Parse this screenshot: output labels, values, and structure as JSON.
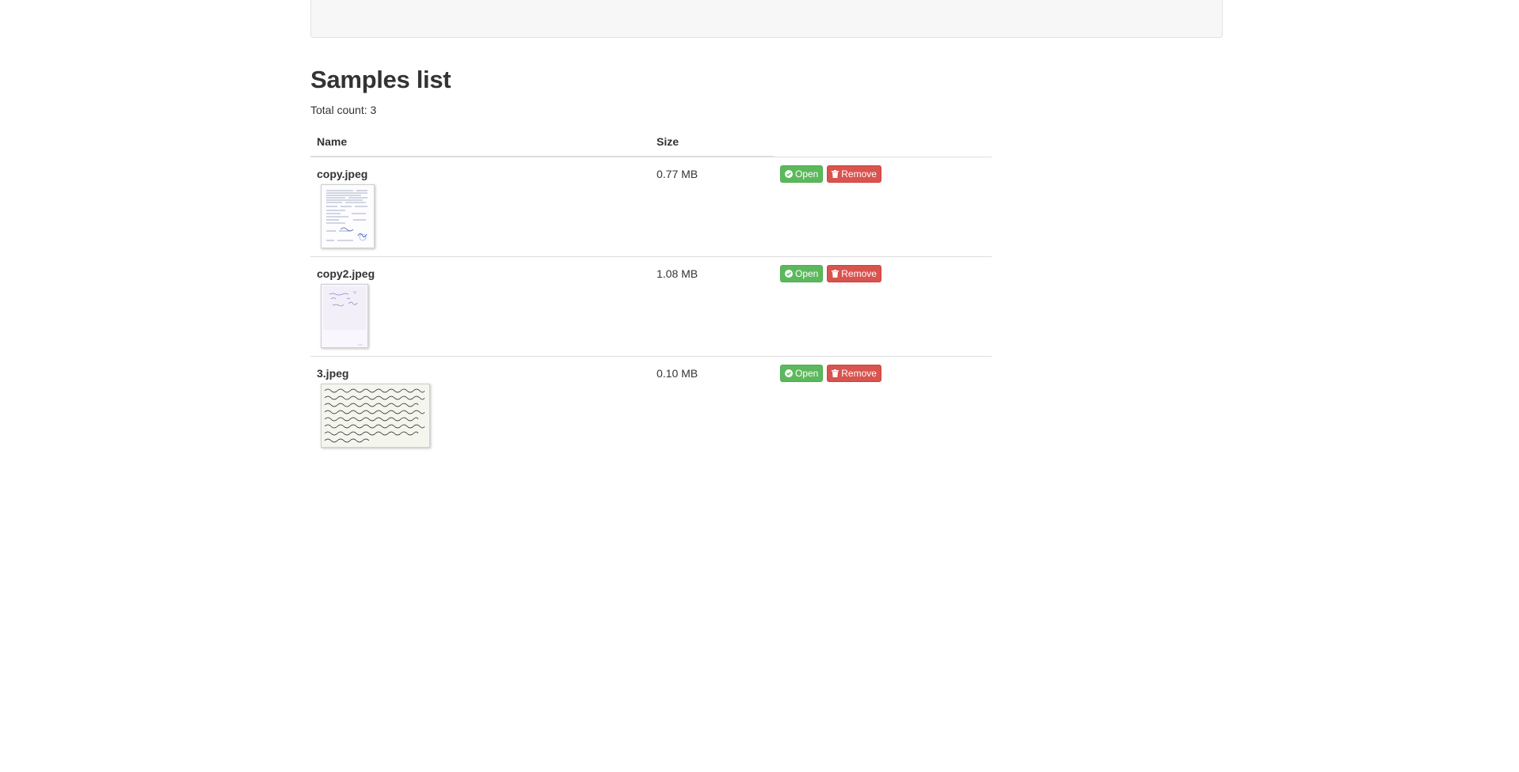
{
  "page": {
    "title": "Samples list",
    "total_label": "Total count: 3"
  },
  "table": {
    "headers": {
      "name": "Name",
      "size": "Size"
    },
    "rows": [
      {
        "name": "copy.jpeg",
        "size": "0.77 MB",
        "open_label": "Open",
        "remove_label": "Remove",
        "thumbnail": "printed-form-thumbnail"
      },
      {
        "name": "copy2.jpeg",
        "size": "1.08 MB",
        "open_label": "Open",
        "remove_label": "Remove",
        "thumbnail": "stamped-note-thumbnail"
      },
      {
        "name": "3.jpeg",
        "size": "0.10 MB",
        "open_label": "Open",
        "remove_label": "Remove",
        "thumbnail": "handwritten-text-thumbnail"
      }
    ]
  },
  "colors": {
    "open_button": "#5cb85c",
    "remove_button": "#d9534f",
    "text": "#333333",
    "topbar": "#f7f7f7"
  },
  "icons": {
    "open": "check-circle-icon",
    "remove": "trash-icon"
  }
}
